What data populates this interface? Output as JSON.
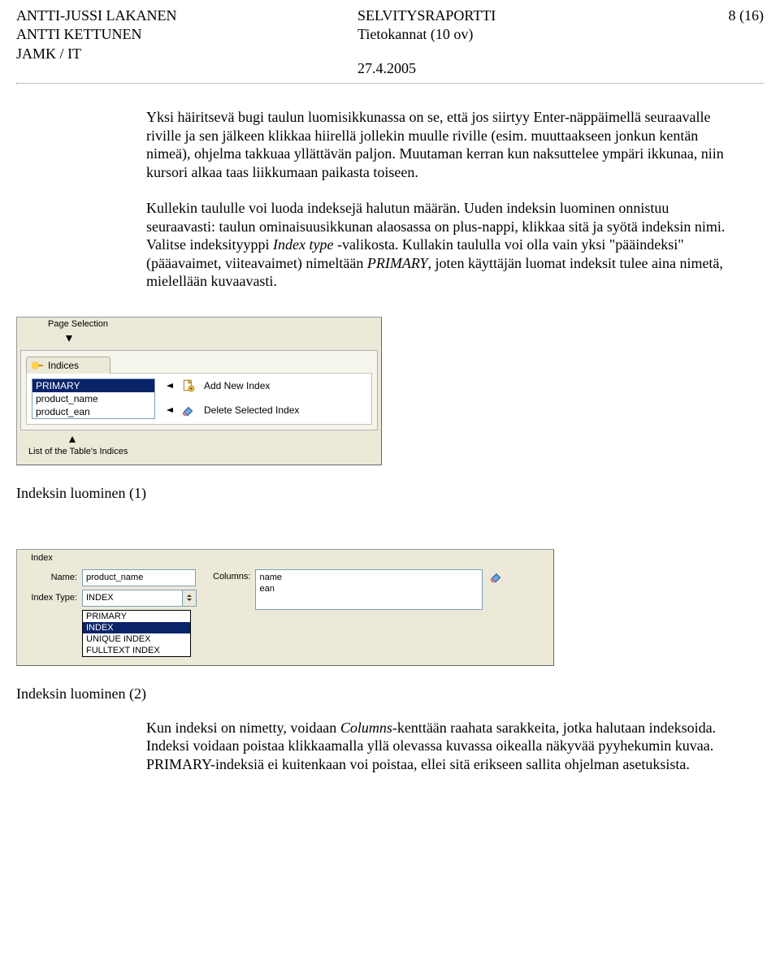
{
  "header": {
    "author1": "ANTTI-JUSSI LAKANEN",
    "author2": "ANTTI KETTUNEN",
    "org": "JAMK / IT",
    "title": "SELVITYSRAPORTTI",
    "course": "Tietokannat (10 ov)",
    "date": "27.4.2005",
    "page": "8 (16)"
  },
  "body": {
    "p1": "Yksi häiritsevä bugi taulun luomisikkunassa on se, että jos siirtyy Enter-näppäimellä seuraavalle riville ja sen jälkeen klikkaa hiirellä jollekin muulle riville (esim. muuttaakseen jonkun kentän nimeä), ohjelma takkuaa yllättävän paljon. Muutaman kerran kun naksuttelee ympäri ikkunaa, niin kursori alkaa taas liikkumaan paikasta toiseen.",
    "p2a": "Kullekin taululle voi luoda indeksejä halutun määrän. Uuden indeksin luominen onnistuu seuraavasti: taulun ominaisuusikkunan alaosassa on plus-nappi, klikkaa sitä ja syötä indeksin nimi. Valitse indeksityyppi ",
    "p2_em1": "Index type",
    "p2b": " -valikosta. Kullakin taululla voi olla vain yksi \"pääindeksi\" (pääavaimet, viiteavaimet) nimeltään ",
    "p2_em2": "PRIMARY",
    "p2c": ", joten käyttäjän luomat indeksit tulee aina nimetä, mielellään kuvaavasti.",
    "p3a": "Kun indeksi on nimetty, voidaan ",
    "p3_em1": "Columns",
    "p3b": "-kenttään raahata sarakkeita, jotka halutaan indeksoida. Indeksi voidaan poistaa klikkaamalla yllä olevassa kuvassa oikealla näkyvää pyyhekumin kuvaa. PRIMARY-indeksiä ei kuitenkaan voi poistaa, ellei sitä erikseen sallita ohjelman asetuksista."
  },
  "captions": {
    "c1": "Indeksin luominen (1)",
    "c2": "Indeksin luominen (2)"
  },
  "shot1": {
    "page_selection": "Page Selection",
    "tab": "Indices",
    "list": [
      "PRIMARY",
      "product_name",
      "product_ean"
    ],
    "add": "Add New Index",
    "del": "Delete Selected Index",
    "bottom": "List of the Table's Indices"
  },
  "shot2": {
    "legend": "Index",
    "name_label": "Name:",
    "name_value": "product_name",
    "type_label": "Index Type:",
    "type_value": "INDEX",
    "columns_label": "Columns:",
    "columns": [
      "name",
      "ean"
    ],
    "options": [
      "PRIMARY",
      "INDEX",
      "UNIQUE INDEX",
      "FULLTEXT INDEX"
    ]
  }
}
